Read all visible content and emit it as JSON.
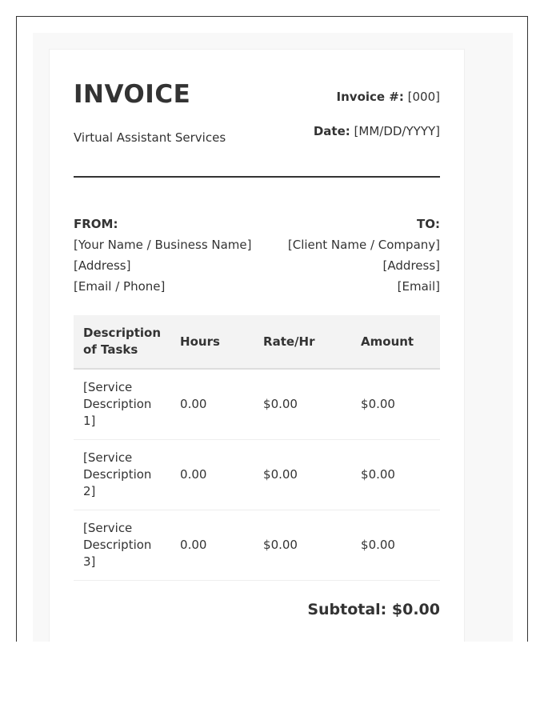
{
  "invoice": {
    "title": "INVOICE",
    "subtitle": "Virtual Assistant Services",
    "invoice_number_label": "Invoice #:",
    "invoice_number_value": "[000]",
    "date_label": "Date:",
    "date_value": "[MM/DD/YYYY]"
  },
  "from": {
    "title": "FROM:",
    "lines": [
      "[Your Name / Business Name]",
      "[Address]",
      "[Email / Phone]"
    ]
  },
  "to": {
    "title": "TO:",
    "lines": [
      "[Client Name / Company]",
      "[Address]",
      "[Email]"
    ]
  },
  "table": {
    "headers": [
      "Description of Tasks",
      "Hours",
      "Rate/Hr",
      "Amount"
    ],
    "rows": [
      [
        "[Service Description 1]",
        "0.00",
        "$0.00",
        "$0.00"
      ],
      [
        "[Service Description 2]",
        "0.00",
        "$0.00",
        "$0.00"
      ],
      [
        "[Service Description 3]",
        "0.00",
        "$0.00",
        "$0.00"
      ]
    ]
  },
  "subtotal": {
    "text": "Subtotal: $0.00"
  }
}
